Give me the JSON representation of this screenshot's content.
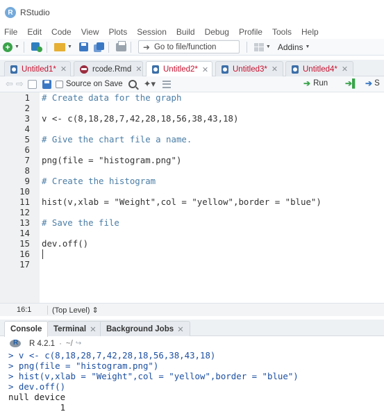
{
  "window": {
    "title": "RStudio",
    "logo_letter": "R"
  },
  "menu": [
    "File",
    "Edit",
    "Code",
    "View",
    "Plots",
    "Session",
    "Build",
    "Debug",
    "Profile",
    "Tools",
    "Help"
  ],
  "toolbar": {
    "goto_label": "Go to file/function",
    "addins_label": "Addins"
  },
  "tabs": [
    {
      "label": "Untitled1*",
      "modified": true,
      "type": "r"
    },
    {
      "label": "rcode.Rmd",
      "modified": false,
      "type": "rmd"
    },
    {
      "label": "Untitled2*",
      "modified": true,
      "type": "r",
      "active": true
    },
    {
      "label": "Untitled3*",
      "modified": true,
      "type": "r"
    },
    {
      "label": "Untitled4*",
      "modified": true,
      "type": "r"
    }
  ],
  "editor_toolbar": {
    "source_on_save": "Source on Save",
    "run_label": "Run",
    "source_label": "S"
  },
  "editor": {
    "lines": [
      {
        "n": "1",
        "text": "# Create data for the graph",
        "comment": true
      },
      {
        "n": "2",
        "text": "",
        "comment": false
      },
      {
        "n": "3",
        "text": "v <- c(8,18,28,7,42,28,18,56,38,43,18)",
        "comment": false
      },
      {
        "n": "4",
        "text": "",
        "comment": false
      },
      {
        "n": "5",
        "text": "# Give the chart file a name.",
        "comment": true
      },
      {
        "n": "6",
        "text": "",
        "comment": false
      },
      {
        "n": "7",
        "text": "png(file = \"histogram.png\")",
        "comment": false
      },
      {
        "n": "8",
        "text": "",
        "comment": false
      },
      {
        "n": "9",
        "text": "# Create the histogram",
        "comment": true
      },
      {
        "n": "10",
        "text": "",
        "comment": false
      },
      {
        "n": "11",
        "text": "hist(v,xlab = \"Weight\",col = \"yellow\",border = \"blue\")",
        "comment": false
      },
      {
        "n": "12",
        "text": "",
        "comment": false
      },
      {
        "n": "13",
        "text": "# Save the file",
        "comment": true
      },
      {
        "n": "14",
        "text": "",
        "comment": false
      },
      {
        "n": "15",
        "text": "dev.off()",
        "comment": false
      },
      {
        "n": "16",
        "text": "",
        "comment": false
      },
      {
        "n": "17",
        "text": "",
        "comment": false
      }
    ]
  },
  "status": {
    "position": "16:1",
    "scope": "(Top Level)"
  },
  "console_tabs": [
    {
      "label": "Console",
      "active": true
    },
    {
      "label": "Terminal",
      "closable": true
    },
    {
      "label": "Background Jobs",
      "closable": true
    }
  ],
  "console": {
    "r_version": "R 4.2.1",
    "working_dir": "~/",
    "lines": [
      {
        "text": "> v <- c(8,18,28,7,42,28,18,56,38,43,18)",
        "kind": "input"
      },
      {
        "text": "> png(file = \"histogram.png\")",
        "kind": "input"
      },
      {
        "text": "> hist(v,xlab = \"Weight\",col = \"yellow\",border = \"blue\")",
        "kind": "input"
      },
      {
        "text": "> dev.off()",
        "kind": "input"
      },
      {
        "text": "null device ",
        "kind": "output"
      },
      {
        "text": "          1 ",
        "kind": "output"
      }
    ]
  },
  "colors": {
    "comment": "#4a7da6",
    "console_input": "#1c4fa1",
    "modified_tab": "#c8102e",
    "accent": "#75aadb"
  }
}
